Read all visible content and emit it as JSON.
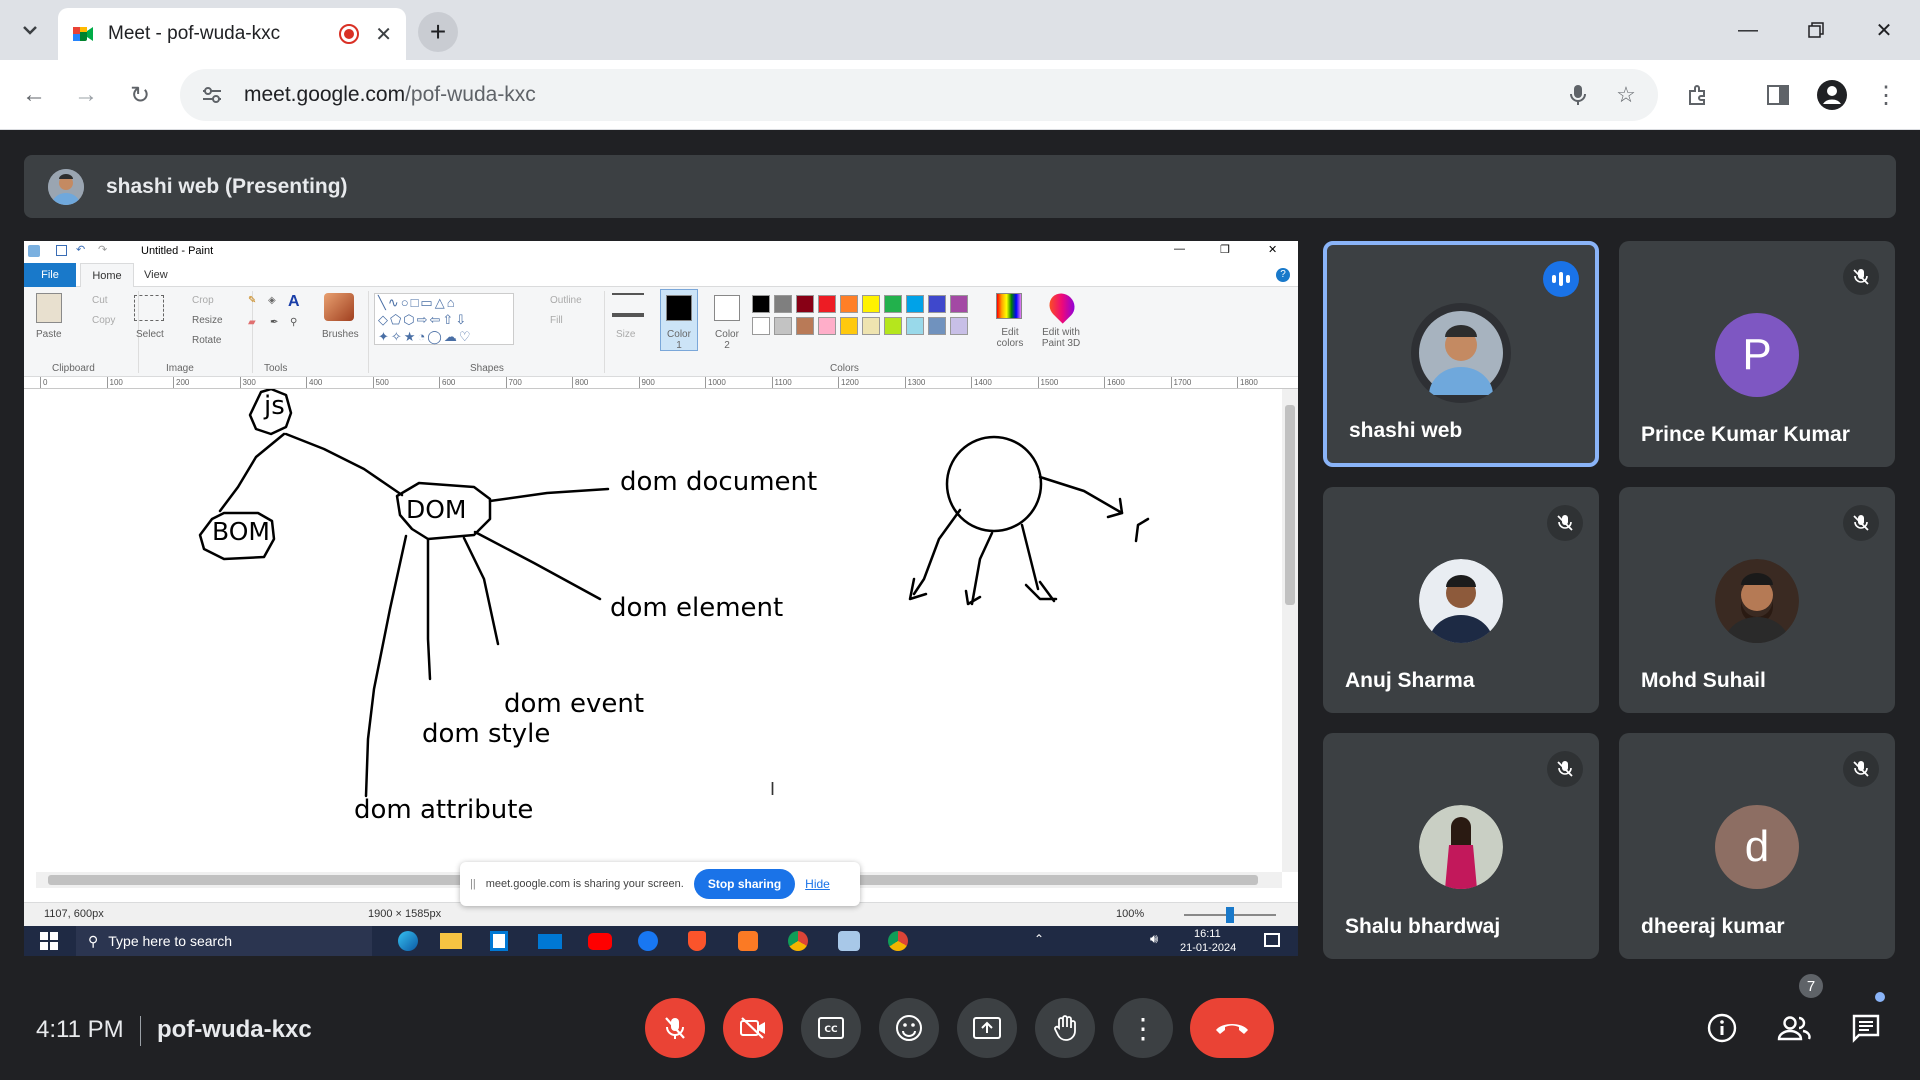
{
  "browser": {
    "tab_title": "Meet - pof-wuda-kxc",
    "url_host": "meet.google.com",
    "url_path": "/pof-wuda-kxc"
  },
  "meet": {
    "presenting_label": "shashi web (Presenting)",
    "time": "4:11 PM",
    "meeting_code": "pof-wuda-kxc",
    "participant_count": "7",
    "participants": [
      {
        "name": "shashi web",
        "speaking": true
      },
      {
        "name": "Prince Kumar Kumar",
        "initial": "P",
        "color": "#7e57c2"
      },
      {
        "name": "Anuj Sharma"
      },
      {
        "name": "Mohd Suhail"
      },
      {
        "name": "Shalu bhardwaj"
      },
      {
        "name": "dheeraj kumar",
        "initial": "d",
        "color": "#8d6e63"
      }
    ]
  },
  "paint": {
    "window_title": "Untitled - Paint",
    "menu": {
      "file": "File",
      "home": "Home",
      "view": "View"
    },
    "ribbon": {
      "paste": "Paste",
      "cut": "Cut",
      "copy": "Copy",
      "clipboard": "Clipboard",
      "select": "Select",
      "crop": "Crop",
      "resize": "Resize",
      "rotate": "Rotate",
      "image": "Image",
      "tools": "Tools",
      "brushes": "Brushes",
      "shapes": "Shapes",
      "outline": "Outline",
      "fill": "Fill",
      "size": "Size",
      "color1": "Color 1",
      "color2": "Color 2",
      "colors": "Colors",
      "edit_colors": "Edit colors",
      "edit_paint3d": "Edit with Paint 3D"
    },
    "ruler_ticks": [
      "0",
      "100",
      "200",
      "300",
      "400",
      "500",
      "600",
      "700",
      "800",
      "900",
      "1000",
      "1100",
      "1200",
      "1300",
      "1400",
      "1500",
      "1600",
      "1700",
      "1800"
    ],
    "canvas_labels": {
      "js": "js",
      "bom": "BOM",
      "dom": "DOM",
      "dom_document": "dom document",
      "dom_element": "dom element",
      "dom_event": "dom event",
      "dom_style": "dom style",
      "dom_attribute": "dom attribute"
    },
    "status": {
      "cursor": "1107, 600px",
      "canvas_size": "1900 × 1585px",
      "zoom": "100%"
    },
    "sharing_notice": "meet.google.com is sharing your screen.",
    "stop_sharing": "Stop sharing",
    "hide": "Hide",
    "palette": [
      "#000000",
      "#7f7f7f",
      "#880015",
      "#ed1c24",
      "#ff7f27",
      "#fff200",
      "#22b14c",
      "#00a2e8",
      "#3f48cc",
      "#a349a4",
      "#ffffff",
      "#c3c3c3",
      "#b97a57",
      "#ffaec9",
      "#ffc90e",
      "#efe4b0",
      "#b5e61d",
      "#99d9ea",
      "#7092be",
      "#c8bfe7"
    ]
  },
  "taskbar": {
    "search_placeholder": "Type here to search",
    "time": "16:11",
    "date": "21-01-2024"
  }
}
